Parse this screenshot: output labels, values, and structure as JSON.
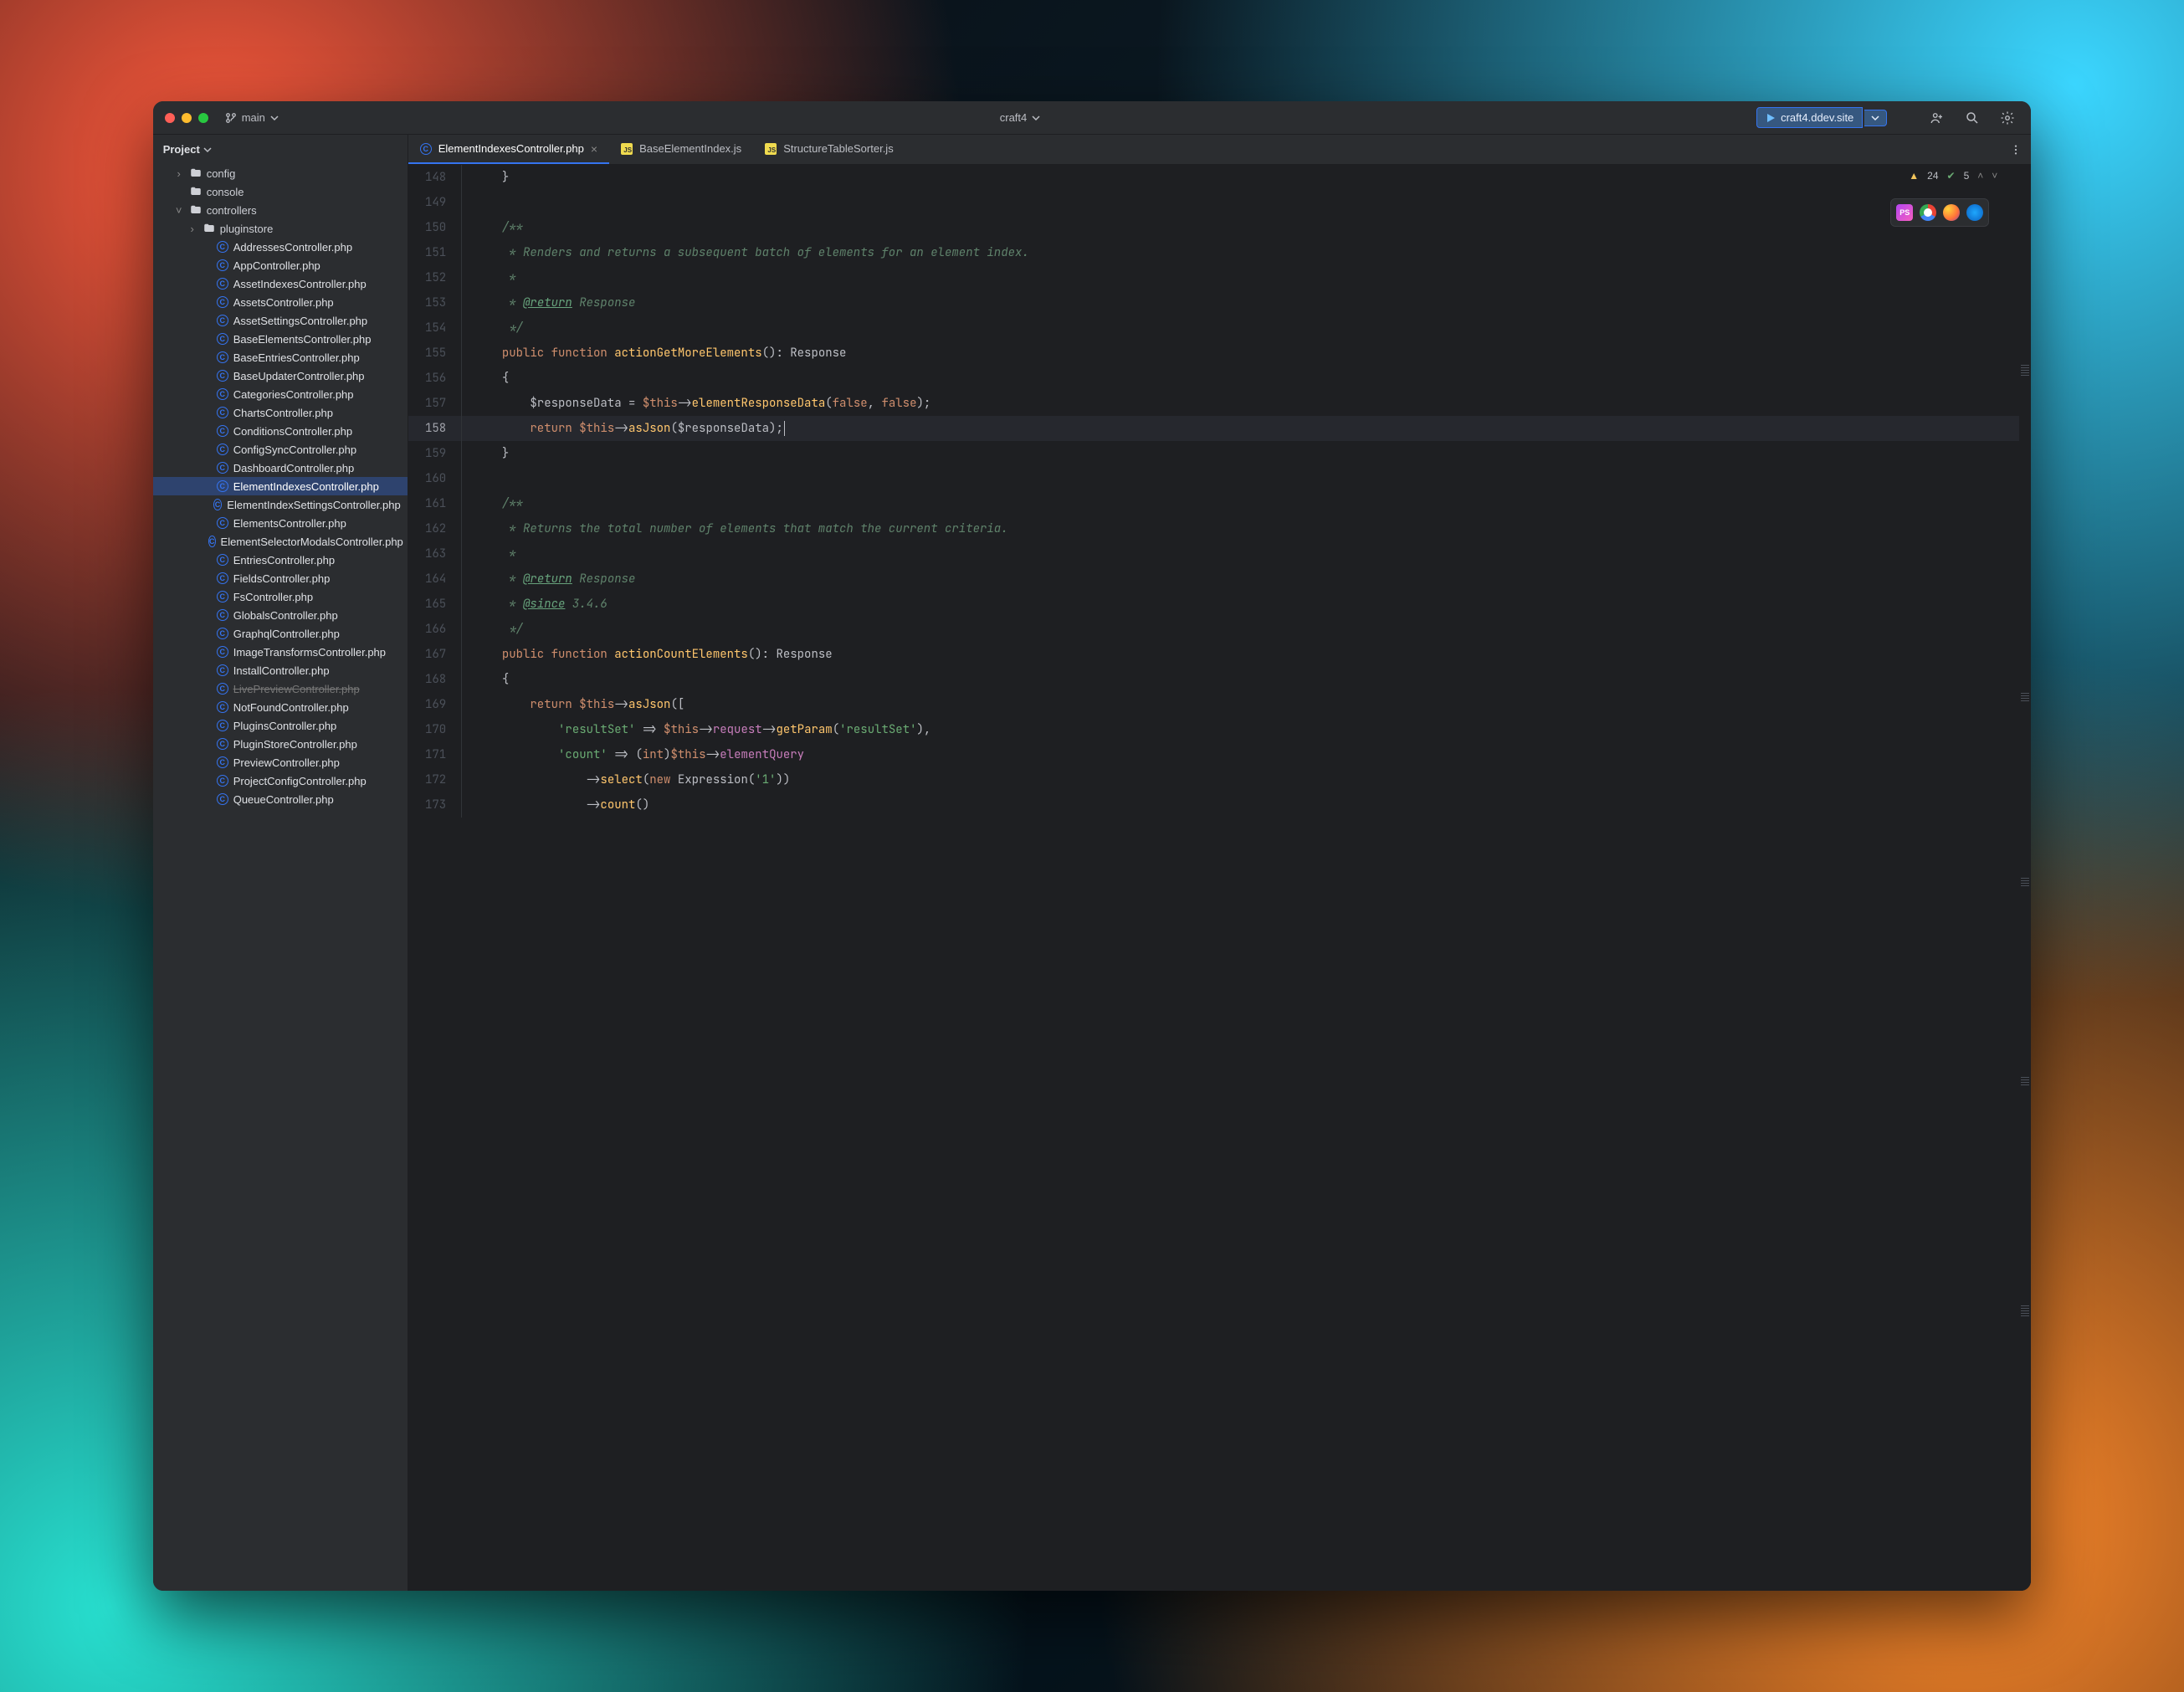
{
  "window": {
    "project_name": "craft4",
    "branch": "main"
  },
  "run": {
    "config_name": "craft4.ddev.site"
  },
  "sidebar": {
    "title": "Project",
    "folders": [
      {
        "name": "config",
        "indent": 1,
        "expanded": false,
        "arrow": true
      },
      {
        "name": "console",
        "indent": 1,
        "expanded": false,
        "arrow": false
      },
      {
        "name": "controllers",
        "indent": 1,
        "expanded": true,
        "arrow": true
      },
      {
        "name": "pluginstore",
        "indent": 2,
        "expanded": false,
        "arrow": true
      }
    ],
    "files": [
      {
        "name": "AddressesController.php"
      },
      {
        "name": "AppController.php"
      },
      {
        "name": "AssetIndexesController.php"
      },
      {
        "name": "AssetsController.php"
      },
      {
        "name": "AssetSettingsController.php"
      },
      {
        "name": "BaseElementsController.php"
      },
      {
        "name": "BaseEntriesController.php"
      },
      {
        "name": "BaseUpdaterController.php"
      },
      {
        "name": "CategoriesController.php"
      },
      {
        "name": "ChartsController.php"
      },
      {
        "name": "ConditionsController.php"
      },
      {
        "name": "ConfigSyncController.php"
      },
      {
        "name": "DashboardController.php"
      },
      {
        "name": "ElementIndexesController.php",
        "selected": true
      },
      {
        "name": "ElementIndexSettingsController.php"
      },
      {
        "name": "ElementsController.php"
      },
      {
        "name": "ElementSelectorModalsController.php"
      },
      {
        "name": "EntriesController.php"
      },
      {
        "name": "FieldsController.php"
      },
      {
        "name": "FsController.php"
      },
      {
        "name": "GlobalsController.php"
      },
      {
        "name": "GraphqlController.php"
      },
      {
        "name": "ImageTransformsController.php"
      },
      {
        "name": "InstallController.php"
      },
      {
        "name": "LivePreviewController.php",
        "strike": true
      },
      {
        "name": "NotFoundController.php"
      },
      {
        "name": "PluginsController.php"
      },
      {
        "name": "PluginStoreController.php"
      },
      {
        "name": "PreviewController.php"
      },
      {
        "name": "ProjectConfigController.php"
      },
      {
        "name": "QueueController.php"
      }
    ]
  },
  "tabs": [
    {
      "label": "ElementIndexesController.php",
      "type": "php",
      "active": true,
      "closeable": true
    },
    {
      "label": "BaseElementIndex.js",
      "type": "js",
      "active": false,
      "closeable": false
    },
    {
      "label": "StructureTableSorter.js",
      "type": "js",
      "active": false,
      "closeable": false
    }
  ],
  "inspection": {
    "warnings": "24",
    "typos": "5"
  },
  "code": {
    "first_line": 148,
    "current_line": 158,
    "lines": [
      {
        "n": 148,
        "html": "    <span class='p'>}</span>"
      },
      {
        "n": 149,
        "html": ""
      },
      {
        "n": 150,
        "html": "    <span class='cd'>/**</span>"
      },
      {
        "n": 151,
        "html": "    <span class='cd'> * Renders and returns a subsequent batch of elements for an element index.</span>"
      },
      {
        "n": 152,
        "html": "    <span class='cd'> *</span>"
      },
      {
        "n": 153,
        "html": "    <span class='cd'> * <span class='tag'>@return</span> Response</span>"
      },
      {
        "n": 154,
        "html": "    <span class='cd'> */</span>"
      },
      {
        "n": 155,
        "html": "    <span class='k'>public</span> <span class='k'>function</span> <span class='fn2'>actionGetMoreElements</span><span class='p'>():</span> <span class='t'>Response</span>"
      },
      {
        "n": 156,
        "html": "    <span class='p'>{</span>"
      },
      {
        "n": 157,
        "html": "        <span class='t'>$responseData</span> <span class='p'>=</span> <span class='k'>$this</span><span class='p'>-></span><span class='callY'>elementResponseData</span><span class='p'>(</span><span class='b'>false</span><span class='p'>,</span> <span class='b'>false</span><span class='p'>);</span>"
      },
      {
        "n": 158,
        "html": "        <span class='k'>return</span> <span class='k'>$this</span><span class='p'>-></span><span class='callY'>asJson</span><span class='p'>(</span><span class='t'>$responseData</span><span class='p'>);</span><span class='caret'></span>"
      },
      {
        "n": 159,
        "html": "    <span class='p'>}</span>"
      },
      {
        "n": 160,
        "html": ""
      },
      {
        "n": 161,
        "html": "    <span class='cd'>/**</span>"
      },
      {
        "n": 162,
        "html": "    <span class='cd'> * Returns the total number of elements that match the current criteria.</span>"
      },
      {
        "n": 163,
        "html": "    <span class='cd'> *</span>"
      },
      {
        "n": 164,
        "html": "    <span class='cd'> * <span class='tag'>@return</span> Response</span>"
      },
      {
        "n": 165,
        "html": "    <span class='cd'> * <span class='tag'>@since</span> 3.4.6</span>"
      },
      {
        "n": 166,
        "html": "    <span class='cd'> */</span>"
      },
      {
        "n": 167,
        "html": "    <span class='k'>public</span> <span class='k'>function</span> <span class='fn2'>actionCountElements</span><span class='p'>():</span> <span class='t'>Response</span>"
      },
      {
        "n": 168,
        "html": "    <span class='p'>{</span>"
      },
      {
        "n": 169,
        "html": "        <span class='k'>return</span> <span class='k'>$this</span><span class='p'>-></span><span class='callY'>asJson</span><span class='p'>([</span>"
      },
      {
        "n": 170,
        "html": "            <span class='s'>'resultSet'</span> <span class='p'>=></span> <span class='k'>$this</span><span class='p'>-></span><span class='prop'>request</span><span class='p'>-></span><span class='callY'>getParam</span><span class='p'>(</span><span class='s'>'resultSet'</span><span class='p'>),</span>"
      },
      {
        "n": 171,
        "html": "            <span class='s'>'count'</span> <span class='p'>=></span> <span class='p'>(</span><span class='b'>int</span><span class='p'>)</span><span class='k'>$this</span><span class='p'>-></span><span class='prop'>elementQuery</span>"
      },
      {
        "n": 172,
        "html": "                <span class='p'>-></span><span class='callY'>select</span><span class='p'>(</span><span class='k'>new</span> <span class='t'>Expression</span><span class='p'>(</span><span class='s'>'1'</span><span class='p'>))</span>"
      },
      {
        "n": 173,
        "html": "                <span class='p'>-></span><span class='callY'>count</span><span class='p'>()</span>"
      }
    ]
  }
}
